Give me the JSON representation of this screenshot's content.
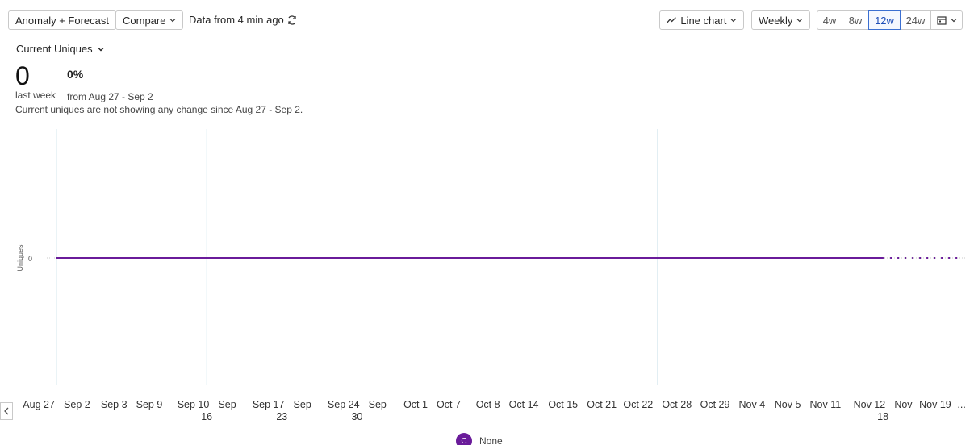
{
  "toolbar": {
    "anomaly_label": "Anomaly + Forecast",
    "compare_label": "Compare",
    "data_freshness": "Data from 4 min ago",
    "chart_type_label": "Line chart",
    "interval_label": "Weekly",
    "ranges": [
      "4w",
      "8w",
      "12w",
      "24w"
    ],
    "active_range": "12w"
  },
  "metric": {
    "name": "Current Uniques",
    "value": "0",
    "period": "last week",
    "change": "0%",
    "change_from": "from Aug 27 - Sep 2",
    "summary": "Current uniques are not showing any change since Aug 27 - Sep 2."
  },
  "legend": {
    "initial": "C",
    "label": "None",
    "color": "#6a1b9a"
  },
  "chart_data": {
    "type": "line",
    "ylabel": "Uniques",
    "xlabel": "",
    "yticks": [
      "0"
    ],
    "categories": [
      [
        "Aug 27 - Sep 2"
      ],
      [
        "Sep 3 - Sep 9"
      ],
      [
        "Sep 10 - Sep",
        "16"
      ],
      [
        "Sep 17 - Sep",
        "23"
      ],
      [
        "Sep 24 - Sep",
        "30"
      ],
      [
        "Oct 1 - Oct 7"
      ],
      [
        "Oct 8 - Oct 14"
      ],
      [
        "Oct 15 - Oct 21"
      ],
      [
        "Oct 22 - Oct 28"
      ],
      [
        "Oct 29 - Nov 4"
      ],
      [
        "Nov 5 - Nov 11"
      ],
      [
        "Nov 12 - Nov",
        "18"
      ],
      [
        "Nov 19 -..."
      ]
    ],
    "series": [
      {
        "values": [
          0,
          0,
          0,
          0,
          0,
          0,
          0,
          0,
          0,
          0,
          0,
          0
        ],
        "color": "#6a1b9a",
        "style": "solid"
      },
      {
        "values": [
          null,
          null,
          null,
          null,
          null,
          null,
          null,
          null,
          null,
          null,
          null,
          0,
          0
        ],
        "color": "#6a1b9a",
        "style": "dotted",
        "forecast": true
      }
    ],
    "annotation_markers": [
      "Aug 27 - Sep 2",
      "Sep 10 - Sep 16",
      "Oct 22 - Oct 28"
    ],
    "grid": false
  }
}
